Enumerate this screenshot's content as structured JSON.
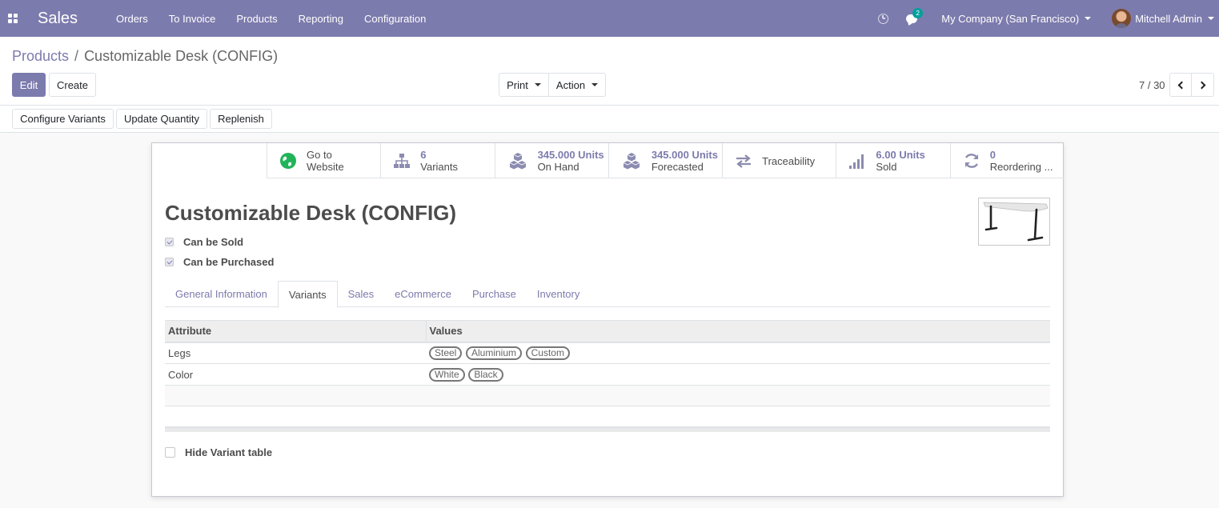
{
  "navbar": {
    "app_name": "Sales",
    "menu": [
      "Orders",
      "To Invoice",
      "Products",
      "Reporting",
      "Configuration"
    ],
    "chat_badge": "2",
    "company": "My Company (San Francisco)",
    "user": "Mitchell Admin",
    "colors": {
      "brand": "#7c7bad",
      "badge": "#00a09d"
    },
    "icons": [
      "apps-grid-icon",
      "clock-icon",
      "chat-icon",
      "avatar"
    ]
  },
  "breadcrumb": {
    "parent": "Products",
    "separator": "/",
    "current": "Customizable Desk (CONFIG)"
  },
  "controls": {
    "edit": "Edit",
    "create": "Create",
    "print": "Print",
    "action": "Action",
    "pager": "7 / 30"
  },
  "statusbar": {
    "buttons": [
      "Configure Variants",
      "Update Quantity",
      "Replenish"
    ]
  },
  "smart_buttons": [
    {
      "icon": "globe-icon",
      "line1": "Go to",
      "line2": "Website"
    },
    {
      "icon": "sitemap-icon",
      "value": "6",
      "label": "Variants"
    },
    {
      "icon": "cubes-icon",
      "value": "345.000 Units",
      "label": "On Hand"
    },
    {
      "icon": "cubes-icon",
      "value": "345.000 Units",
      "label": "Forecasted"
    },
    {
      "icon": "exchange-icon",
      "text": "Traceability"
    },
    {
      "icon": "signal-icon",
      "value": "6.00 Units",
      "label": "Sold"
    },
    {
      "icon": "refresh-icon",
      "value": "0",
      "label": "Reordering ..."
    }
  ],
  "product": {
    "name": "Customizable Desk (CONFIG)",
    "can_be_sold": "Can be Sold",
    "can_be_purchased": "Can be Purchased",
    "can_be_sold_checked": true,
    "can_be_purchased_checked": true
  },
  "tabs": [
    "General Information",
    "Variants",
    "Sales",
    "eCommerce",
    "Purchase",
    "Inventory"
  ],
  "active_tab": "Variants",
  "variants_table": {
    "columns": [
      "Attribute",
      "Values"
    ],
    "rows": [
      {
        "attribute": "Legs",
        "values": [
          "Steel",
          "Aluminium",
          "Custom"
        ]
      },
      {
        "attribute": "Color",
        "values": [
          "White",
          "Black"
        ]
      }
    ]
  },
  "hide_variant_table": {
    "label": "Hide Variant table",
    "checked": false
  }
}
